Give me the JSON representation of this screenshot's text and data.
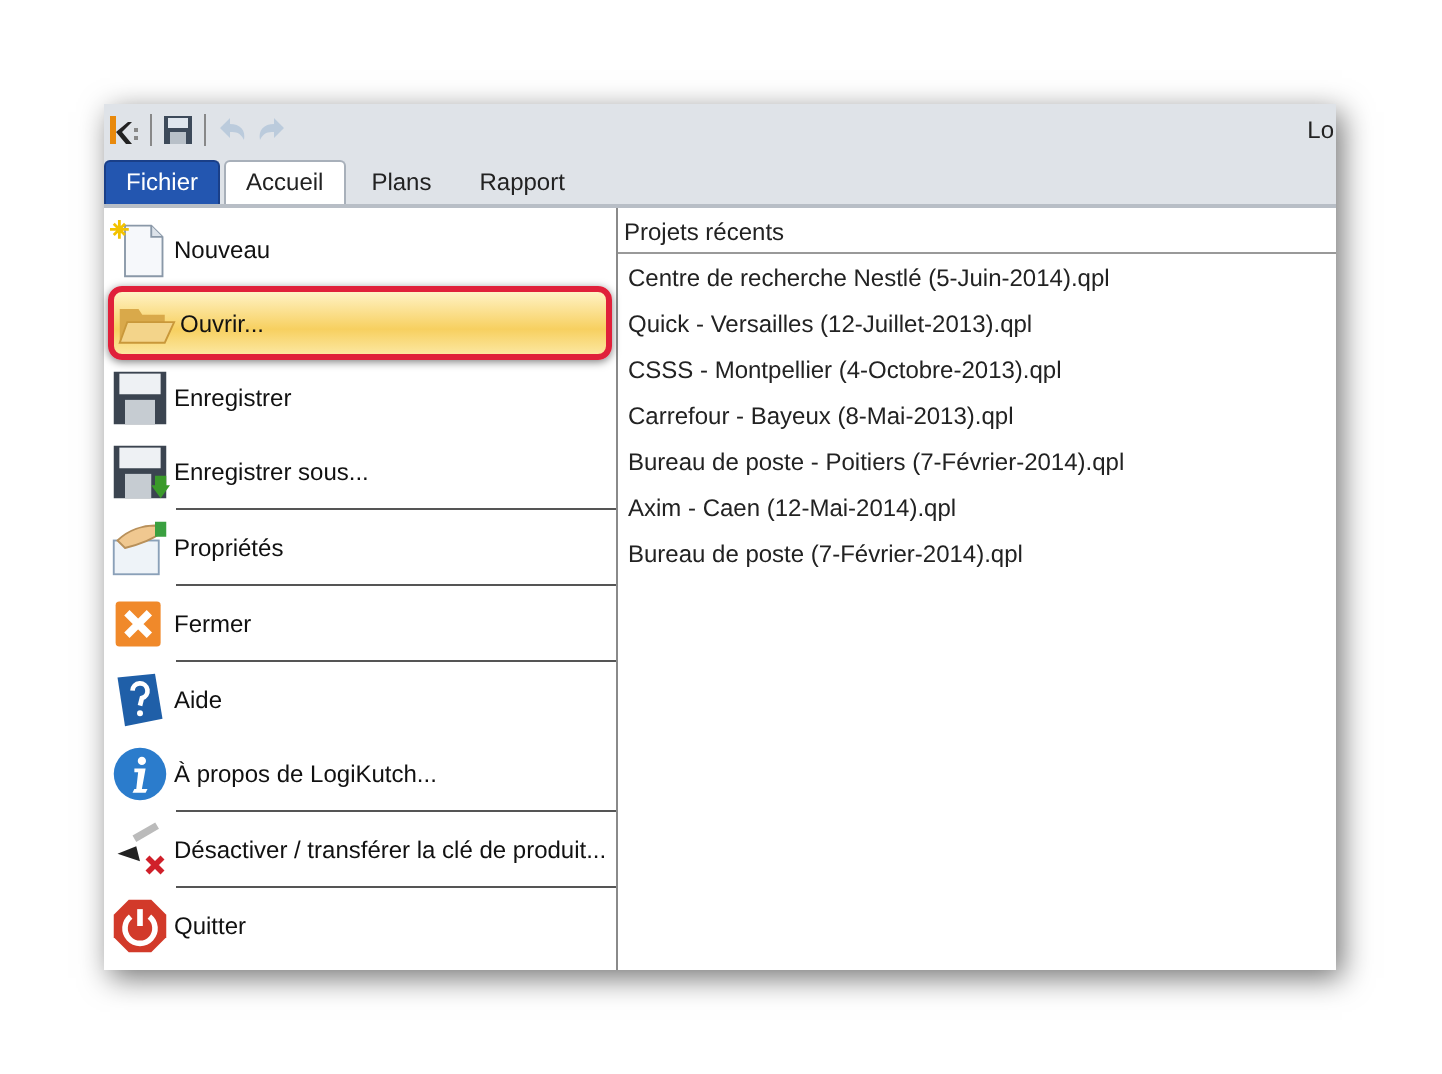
{
  "window": {
    "title": "Lo"
  },
  "quick_access": [
    {
      "kind": "logo"
    },
    {
      "kind": "save",
      "disabled": false
    },
    {
      "kind": "undo",
      "disabled": true
    },
    {
      "kind": "redo",
      "disabled": true
    }
  ],
  "tabs": [
    {
      "label": "Fichier",
      "kind": "file",
      "selected": false
    },
    {
      "label": "Accueil",
      "kind": "tab",
      "selected": true
    },
    {
      "label": "Plans",
      "kind": "tab",
      "selected": false
    },
    {
      "label": "Rapport",
      "kind": "tab",
      "selected": false
    }
  ],
  "file_menu": {
    "items": [
      {
        "label": "Nouveau",
        "kind": "new",
        "selected": false,
        "separator_after": false
      },
      {
        "label": "Ouvrir...",
        "kind": "open",
        "selected": true,
        "separator_after": false
      },
      {
        "label": "Enregistrer",
        "kind": "save",
        "selected": false,
        "separator_after": false
      },
      {
        "label": "Enregistrer sous...",
        "kind": "saveas",
        "selected": false,
        "separator_after": true
      },
      {
        "label": "Propriétés",
        "kind": "properties",
        "selected": false,
        "separator_after": true
      },
      {
        "label": "Fermer",
        "kind": "close",
        "selected": false,
        "separator_after": true
      },
      {
        "label": "Aide",
        "kind": "help",
        "selected": false,
        "separator_after": false
      },
      {
        "label": "À propos de LogiKutch...",
        "kind": "info",
        "selected": false,
        "separator_after": true
      },
      {
        "label": "Désactiver / transférer la clé de produit...",
        "kind": "key",
        "selected": false,
        "separator_after": true
      },
      {
        "label": "Quitter",
        "kind": "quit",
        "selected": false,
        "separator_after": false
      }
    ]
  },
  "recent_projects": {
    "title": "Projets récents",
    "items": [
      "Centre de recherche Nestlé (5-Juin-2014).qpl",
      "Quick - Versailles (12-Juillet-2013).qpl",
      "CSSS - Montpellier (4-Octobre-2013).qpl",
      "Carrefour - Bayeux (8-Mai-2013).qpl",
      "Bureau de poste - Poitiers (7-Février-2014).qpl",
      "Axim - Caen (12-Mai-2014).qpl",
      "Bureau de poste (7-Février-2014).qpl"
    ]
  }
}
